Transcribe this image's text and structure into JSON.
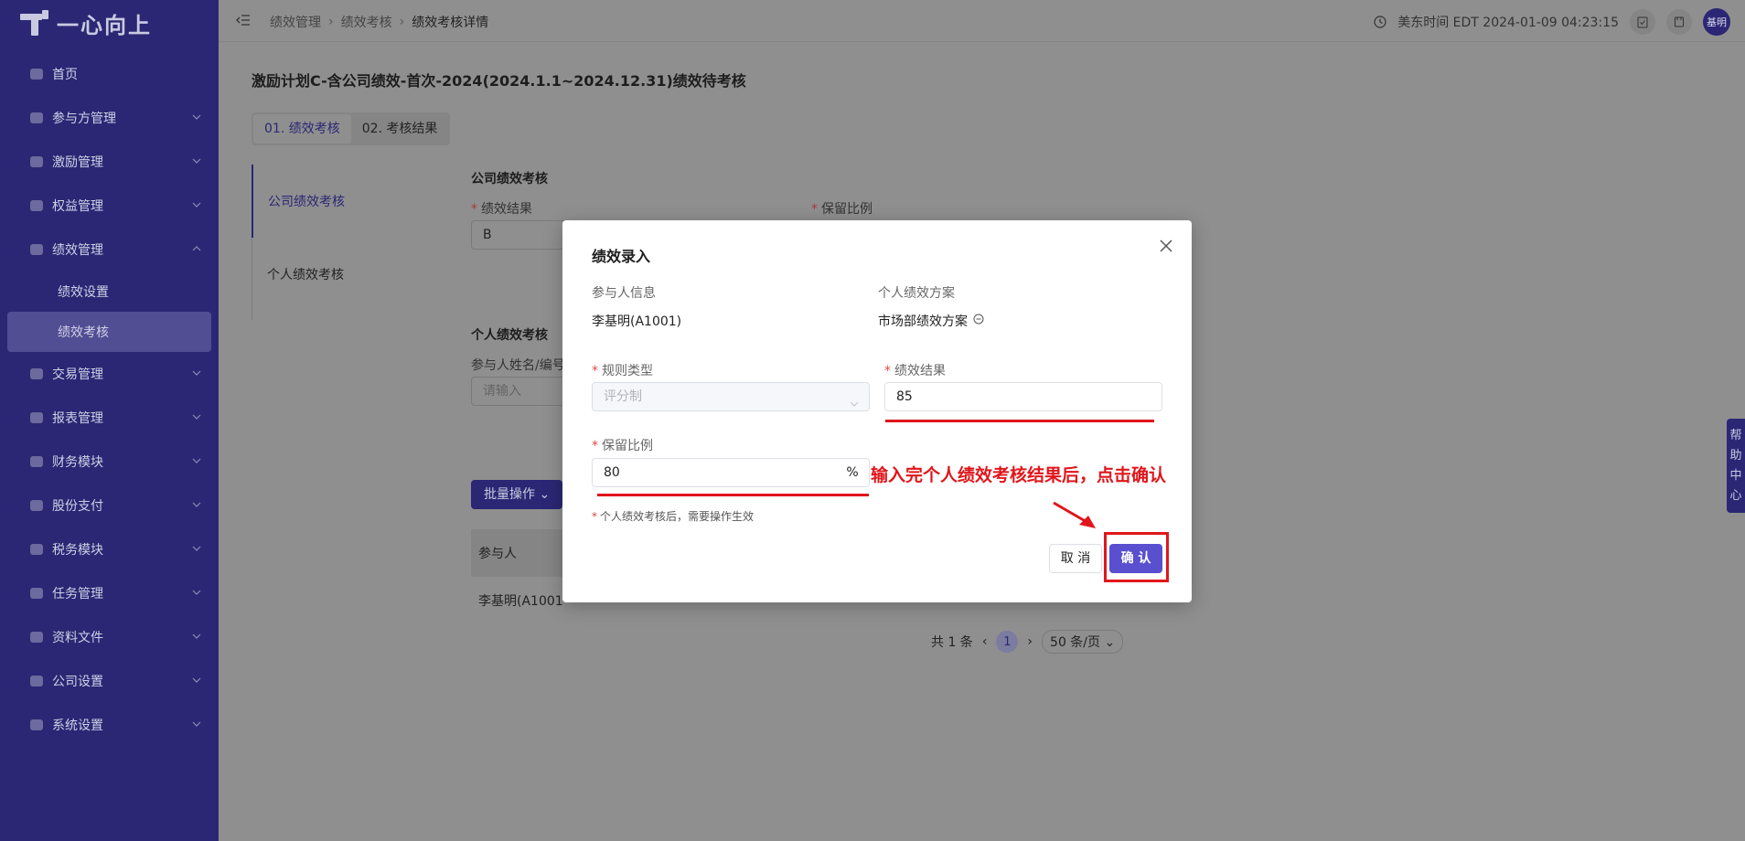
{
  "brand": {
    "name": "一心向上"
  },
  "sidebar": {
    "items": [
      {
        "label": "首页",
        "icon": "home-icon",
        "expandable": false
      },
      {
        "label": "参与方管理",
        "icon": "participant-icon",
        "expandable": true
      },
      {
        "label": "激励管理",
        "icon": "incentive-icon",
        "expandable": true
      },
      {
        "label": "权益管理",
        "icon": "equity-icon",
        "expandable": true
      },
      {
        "label": "绩效管理",
        "icon": "crown-icon",
        "expandable": true,
        "expanded": true,
        "children": [
          {
            "label": "绩效设置"
          },
          {
            "label": "绩效考核",
            "active": true
          }
        ]
      },
      {
        "label": "交易管理",
        "icon": "trade-icon",
        "expandable": true
      },
      {
        "label": "报表管理",
        "icon": "report-icon",
        "expandable": true
      },
      {
        "label": "财务模块",
        "icon": "finance-icon",
        "expandable": true
      },
      {
        "label": "股份支付",
        "icon": "share-pay-icon",
        "expandable": true
      },
      {
        "label": "税务模块",
        "icon": "tax-icon",
        "expandable": true
      },
      {
        "label": "任务管理",
        "icon": "task-icon",
        "expandable": true
      },
      {
        "label": "资料文件",
        "icon": "file-icon",
        "expandable": true
      },
      {
        "label": "公司设置",
        "icon": "company-icon",
        "expandable": true
      },
      {
        "label": "系统设置",
        "icon": "system-icon",
        "expandable": true
      }
    ]
  },
  "topbar": {
    "breadcrumb": [
      "绩效管理",
      "绩效考核",
      "绩效考核详情"
    ],
    "time_label": "美东时间 EDT 2024-01-09 04:23:15",
    "avatar_text": "基明"
  },
  "page": {
    "title": "激励计划C-含公司绩效-首次-2024(2024.1.1~2024.12.31)绩效待考核",
    "steps": [
      "01. 绩效考核",
      "02. 考核结果"
    ],
    "vtabs": [
      "公司绩效考核",
      "个人绩效考核"
    ],
    "company_section": {
      "title": "公司绩效考核",
      "result_label": "绩效结果",
      "result_value": "B",
      "ratio_label": "保留比例"
    },
    "personal_section": {
      "title": "个人绩效考核",
      "search_label": "参与人姓名/编号",
      "search_placeholder": "请输入"
    },
    "batch_button": "批量操作",
    "table": {
      "header": "参与人",
      "rows": [
        "李基明(A1001"
      ]
    },
    "pagination": {
      "total": "共 1 条",
      "current": "1",
      "page_size": "50 条/页"
    },
    "help_tab": [
      "帮",
      "助",
      "中",
      "心"
    ]
  },
  "modal": {
    "title": "绩效录入",
    "participant_label": "参与人信息",
    "participant_value": "李基明(A1001)",
    "plan_label": "个人绩效方案",
    "plan_value": "市场部绩效方案",
    "rule_type_label": "规则类型",
    "rule_type_value": "评分制",
    "result_label": "绩效结果",
    "result_value": "85",
    "ratio_label": "保留比例",
    "ratio_value": "80",
    "ratio_suffix": "%",
    "note": "个人绩效考核后，需要操作生效",
    "cancel": "取 消",
    "confirm": "确 认"
  },
  "annotation": {
    "text": "输入完个人绩效考核结果后，点击确认",
    "color": "#e0161b"
  },
  "colors": {
    "sidebar_bg": "#2b2774",
    "primary": "#5a4fcf",
    "overlay": "#8f8f8f"
  }
}
